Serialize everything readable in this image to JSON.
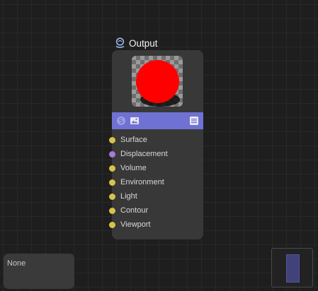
{
  "node": {
    "title": "Output",
    "title_icon": "output-node-icon",
    "preview": {
      "sphere_color": "#ff0000"
    },
    "toolbar": {
      "color": "#6f71d3",
      "icons": [
        "shader-icon",
        "image-icon",
        "menu-icon"
      ]
    },
    "inputs": [
      {
        "label": "Surface",
        "color": "#d9c24a"
      },
      {
        "label": "Displacement",
        "color": "#a679d6"
      },
      {
        "label": "Volume",
        "color": "#d9c24a"
      },
      {
        "label": "Environment",
        "color": "#d9c24a"
      },
      {
        "label": "Light",
        "color": "#d9c24a"
      },
      {
        "label": "Contour",
        "color": "#d9c24a"
      },
      {
        "label": "Viewport",
        "color": "#d9c24a"
      }
    ]
  },
  "info_panel": {
    "text": "None"
  },
  "minimap": {
    "view_color": "#41427a"
  }
}
